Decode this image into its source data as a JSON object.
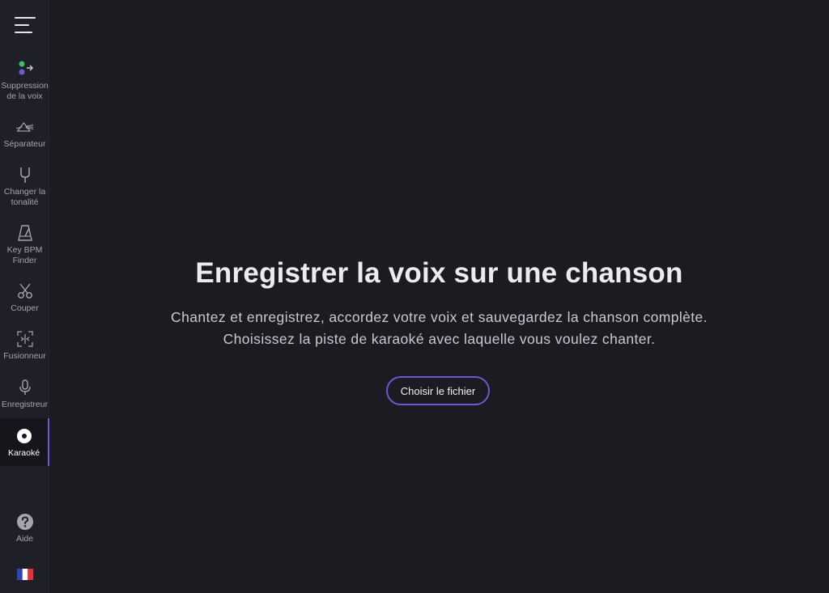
{
  "sidebar": {
    "menu_icon": "hamburger-menu-icon",
    "items": [
      {
        "label": "Suppression\nde la voix",
        "icon": "vocal-remover-icon",
        "active": false
      },
      {
        "label": "Séparateur",
        "icon": "splitter-prism-icon",
        "active": false
      },
      {
        "label": "Changer la\ntonalité",
        "icon": "tuning-fork-icon",
        "active": false
      },
      {
        "label": "Key BPM\nFinder",
        "icon": "metronome-icon",
        "active": false
      },
      {
        "label": "Couper",
        "icon": "scissors-icon",
        "active": false
      },
      {
        "label": "Fusionneur",
        "icon": "joiner-icon",
        "active": false
      },
      {
        "label": "Enregistreur",
        "icon": "microphone-icon",
        "active": false
      },
      {
        "label": "Karaoké",
        "icon": "karaoke-disc-icon",
        "active": true
      }
    ],
    "help": {
      "label": "Aide",
      "icon": "help-icon"
    },
    "language": {
      "icon": "french-flag-icon"
    }
  },
  "main": {
    "title": "Enregistrer la voix sur une chanson",
    "subtitle_line1": "Chantez et enregistrez, accordez votre voix et sauvegardez la chanson complète.",
    "subtitle_line2": "Choisissez la piste de karaoké avec laquelle vous voulez chanter.",
    "choose_button": "Choisir le fichier"
  },
  "colors": {
    "background": "#1b1b22",
    "sidebar": "#1f1f28",
    "accent": "#6a5ad2",
    "active_item_bg": "#15151b"
  }
}
